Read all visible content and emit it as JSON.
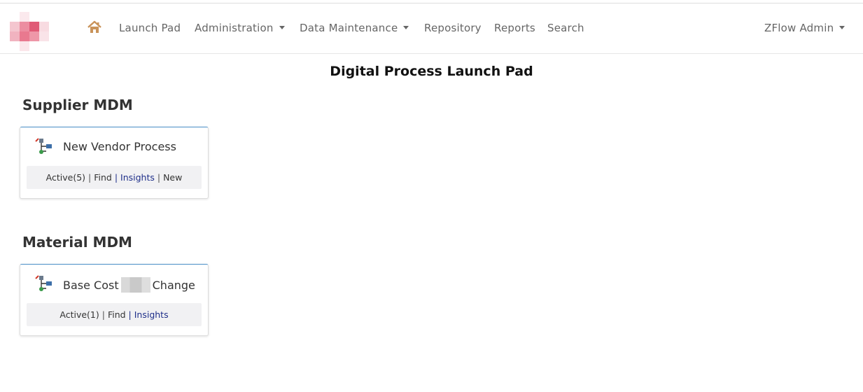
{
  "nav": {
    "items": [
      {
        "label": "Launch Pad",
        "dropdown": false
      },
      {
        "label": "Administration",
        "dropdown": true
      },
      {
        "label": "Data Maintenance",
        "dropdown": true
      },
      {
        "label": "Repository",
        "dropdown": false
      },
      {
        "label": "Reports",
        "dropdown": false
      },
      {
        "label": "Search",
        "dropdown": false
      }
    ],
    "user": "ZFlow Admin",
    "icons": {
      "home": "home-icon",
      "logo": "logo-icon"
    },
    "colors": {
      "home": "#c9935a",
      "logo": "#e8788e"
    }
  },
  "page_title": "Digital Process Launch Pad",
  "sections": [
    {
      "title": "Supplier MDM",
      "card": {
        "title": "New Vendor Process",
        "links": {
          "active": "Active(5)",
          "find": "Find",
          "insights": "Insights",
          "new": "New"
        }
      }
    },
    {
      "title": "Material MDM",
      "card": {
        "title_before": "Base Cost",
        "title_after": "Change",
        "links": {
          "active": "Active(1)",
          "find": "Find",
          "insights": "Insights"
        }
      }
    }
  ]
}
